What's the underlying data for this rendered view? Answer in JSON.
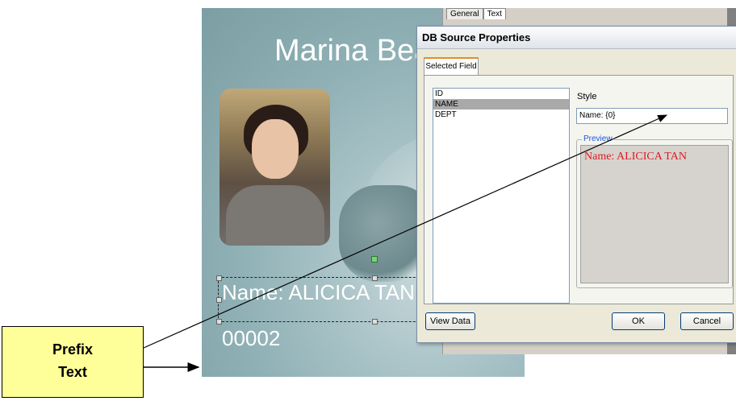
{
  "badge": {
    "title": "Marina Beac",
    "name_text": "Name:  ALICICA TAN",
    "id_text": "00002"
  },
  "panel": {
    "tabs": [
      "General",
      "Text"
    ]
  },
  "dialog": {
    "title": "DB Source Properties",
    "tab": "Selected Field",
    "fields": [
      "ID",
      "NAME",
      "DEPT"
    ],
    "selected_field": "NAME",
    "style_label": "Style",
    "style_value": "Name: {0}",
    "preview_label": "Preview",
    "preview_text": "Name:  ALICICA TAN",
    "buttons": {
      "view_data": "View Data",
      "ok": "OK",
      "cancel": "Cancel"
    }
  },
  "callout": {
    "line1": "Prefix",
    "line2": "Text"
  },
  "colors": {
    "preview_text": "#e0191f",
    "callout_bg": "#ffff99",
    "preview_legend": "#1a55d8"
  }
}
